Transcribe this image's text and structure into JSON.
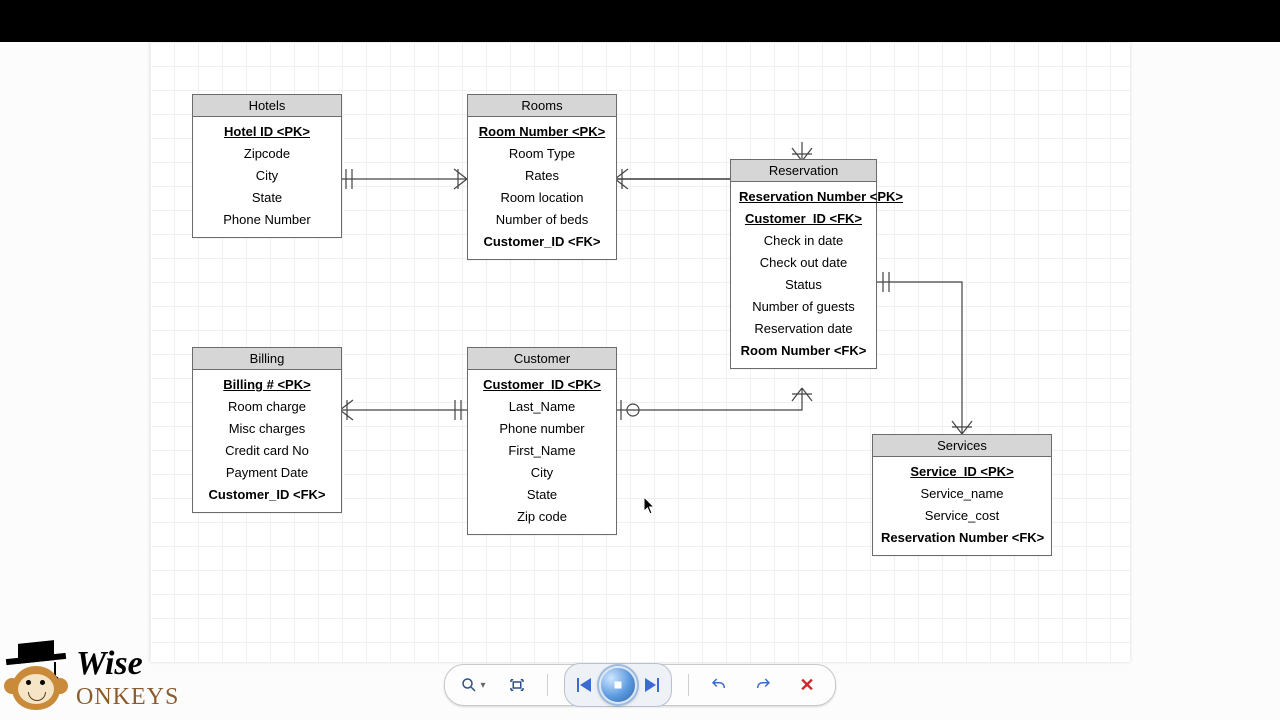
{
  "entities": {
    "hotels": {
      "title": "Hotels",
      "attrs": [
        {
          "text": "Hotel ID <PK>",
          "pk": true
        },
        {
          "text": "Zipcode"
        },
        {
          "text": "City"
        },
        {
          "text": "State"
        },
        {
          "text": "Phone Number"
        }
      ]
    },
    "rooms": {
      "title": "Rooms",
      "attrs": [
        {
          "text": "Room Number <PK>",
          "pk": true
        },
        {
          "text": "Room Type"
        },
        {
          "text": "Rates"
        },
        {
          "text": "Room location"
        },
        {
          "text": "Number of beds"
        },
        {
          "text": "Customer_ID <FK>",
          "fk": true
        }
      ]
    },
    "reservation": {
      "title": "Reservation",
      "attrs": [
        {
          "text": "Reservation Number <PK>",
          "pk": true
        },
        {
          "text": "Customer_ID <FK>",
          "pk": true
        },
        {
          "text": "Check in date"
        },
        {
          "text": "Check out date"
        },
        {
          "text": "Status"
        },
        {
          "text": "Number of guests"
        },
        {
          "text": "Reservation date"
        },
        {
          "text": "Room Number <FK>",
          "fk": true
        }
      ]
    },
    "billing": {
      "title": "Billing",
      "attrs": [
        {
          "text": "Billing # <PK>",
          "pk": true
        },
        {
          "text": "Room charge"
        },
        {
          "text": "Misc charges"
        },
        {
          "text": "Credit card No"
        },
        {
          "text": "Payment Date"
        },
        {
          "text": "Customer_ID <FK>",
          "fk": true
        }
      ]
    },
    "customer": {
      "title": "Customer",
      "attrs": [
        {
          "text": "Customer_ID <PK>",
          "pk": true
        },
        {
          "text": "Last_Name"
        },
        {
          "text": "Phone number"
        },
        {
          "text": "First_Name"
        },
        {
          "text": "City"
        },
        {
          "text": "State"
        },
        {
          "text": "Zip code"
        }
      ]
    },
    "services": {
      "title": "Services",
      "attrs": [
        {
          "text": "Service_ID <PK>",
          "pk": true
        },
        {
          "text": "Service_name"
        },
        {
          "text": "Service_cost"
        },
        {
          "text": "Reservation Number <FK>",
          "fk": true
        }
      ]
    }
  },
  "logo": {
    "line1": "Wise",
    "line2": "onkeys"
  },
  "toolbar": {
    "zoom": "Zoom",
    "fit": "Fit on screen",
    "first": "First",
    "stop": "Stop",
    "next": "Next",
    "undo": "Undo",
    "redo": "Redo",
    "close": "Close"
  }
}
